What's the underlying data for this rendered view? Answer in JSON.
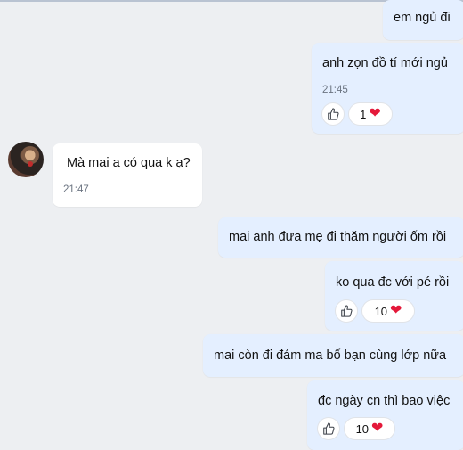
{
  "messages": [
    {
      "text": "em ngủ đi"
    },
    {
      "text": "anh zọn đồ tí mới ngủ",
      "time": "21:45",
      "reaction_count": "1"
    },
    {
      "text": "Mà mai a có qua k ạ?",
      "time": "21:47"
    },
    {
      "text": "mai anh đưa mẹ đi thăm người ốm rồi"
    },
    {
      "text": "ko qua đc với pé rồi",
      "reaction_count": "10"
    },
    {
      "text": "mai còn đi đám ma bố bạn cùng lớp nữa"
    },
    {
      "text": "đc ngày cn thì bao việc",
      "reaction_count": "10"
    }
  ],
  "icons": {
    "like": "thumbs-up-icon",
    "reaction": "heart-icon",
    "avatar": "contact-avatar"
  },
  "colors": {
    "sent_bubble": "#e4efff",
    "received_bubble": "#ffffff",
    "background": "#edeff2",
    "heart": "#e4193a"
  }
}
